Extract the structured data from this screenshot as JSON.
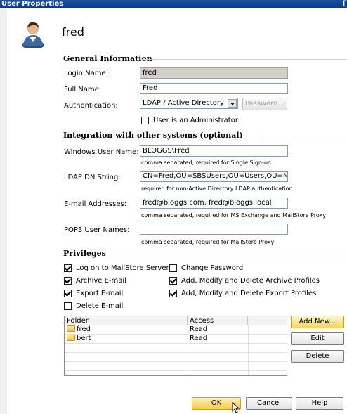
{
  "window": {
    "title": "User Properties",
    "close_label": "["
  },
  "user": {
    "name": "fred"
  },
  "general": {
    "heading": "General Information",
    "login_label": "Login Name:",
    "login_value": "fred",
    "fullname_label": "Full Name:",
    "fullname_value": "Fred",
    "auth_label": "Authentication:",
    "auth_value": "LDAP / Active Directory",
    "password_button": "Password...",
    "admin_label": "User is an Administrator",
    "admin_checked": false
  },
  "integration": {
    "heading": "Integration with other systems (optional)",
    "windows_label": "Windows User Name:",
    "windows_value": "BLOGGS\\Fred",
    "windows_hint": "comma separated, required for Single Sign-on",
    "ldap_label": "LDAP DN String:",
    "ldap_value": "CN=Fred,OU=SBSUsers,OU=Users,OU=MyBusin",
    "ldap_hint": "required for non-Active Directory LDAP authentication",
    "email_label": "E-mail Addresses:",
    "email_value": "fred@bloggs.com, fred@bloggs.local",
    "email_hint": "comma separated, required for MS Exchange and MailStore Proxy",
    "pop3_label": "POP3 User Names:",
    "pop3_value": "",
    "pop3_hint": "comma separated, required for MailStore Proxy"
  },
  "privileges": {
    "heading": "Privileges",
    "items": [
      {
        "label": "Log on to MailStore Server",
        "checked": true
      },
      {
        "label": "Archive E-mail",
        "checked": true
      },
      {
        "label": "Export E-mail",
        "checked": true
      },
      {
        "label": "Delete E-mail",
        "checked": false
      },
      {
        "label": "Change Password",
        "checked": false
      },
      {
        "label": "Add, Modify and Delete Archive Profiles",
        "checked": true
      },
      {
        "label": "Add, Modify and Delete Export Profiles",
        "checked": true
      }
    ]
  },
  "folders": {
    "columns": [
      "Folder",
      "Access"
    ],
    "rows": [
      {
        "folder": "fred",
        "access": "Read"
      },
      {
        "folder": "bert",
        "access": "Read"
      }
    ],
    "add_button": "Add New...",
    "edit_button": "Edit",
    "delete_button": "Delete"
  },
  "footer": {
    "ok": "OK",
    "cancel": "Cancel",
    "help": "Help"
  },
  "colors": {
    "titlebar": "#0a3a86",
    "focus_button": "#f4d46a"
  }
}
